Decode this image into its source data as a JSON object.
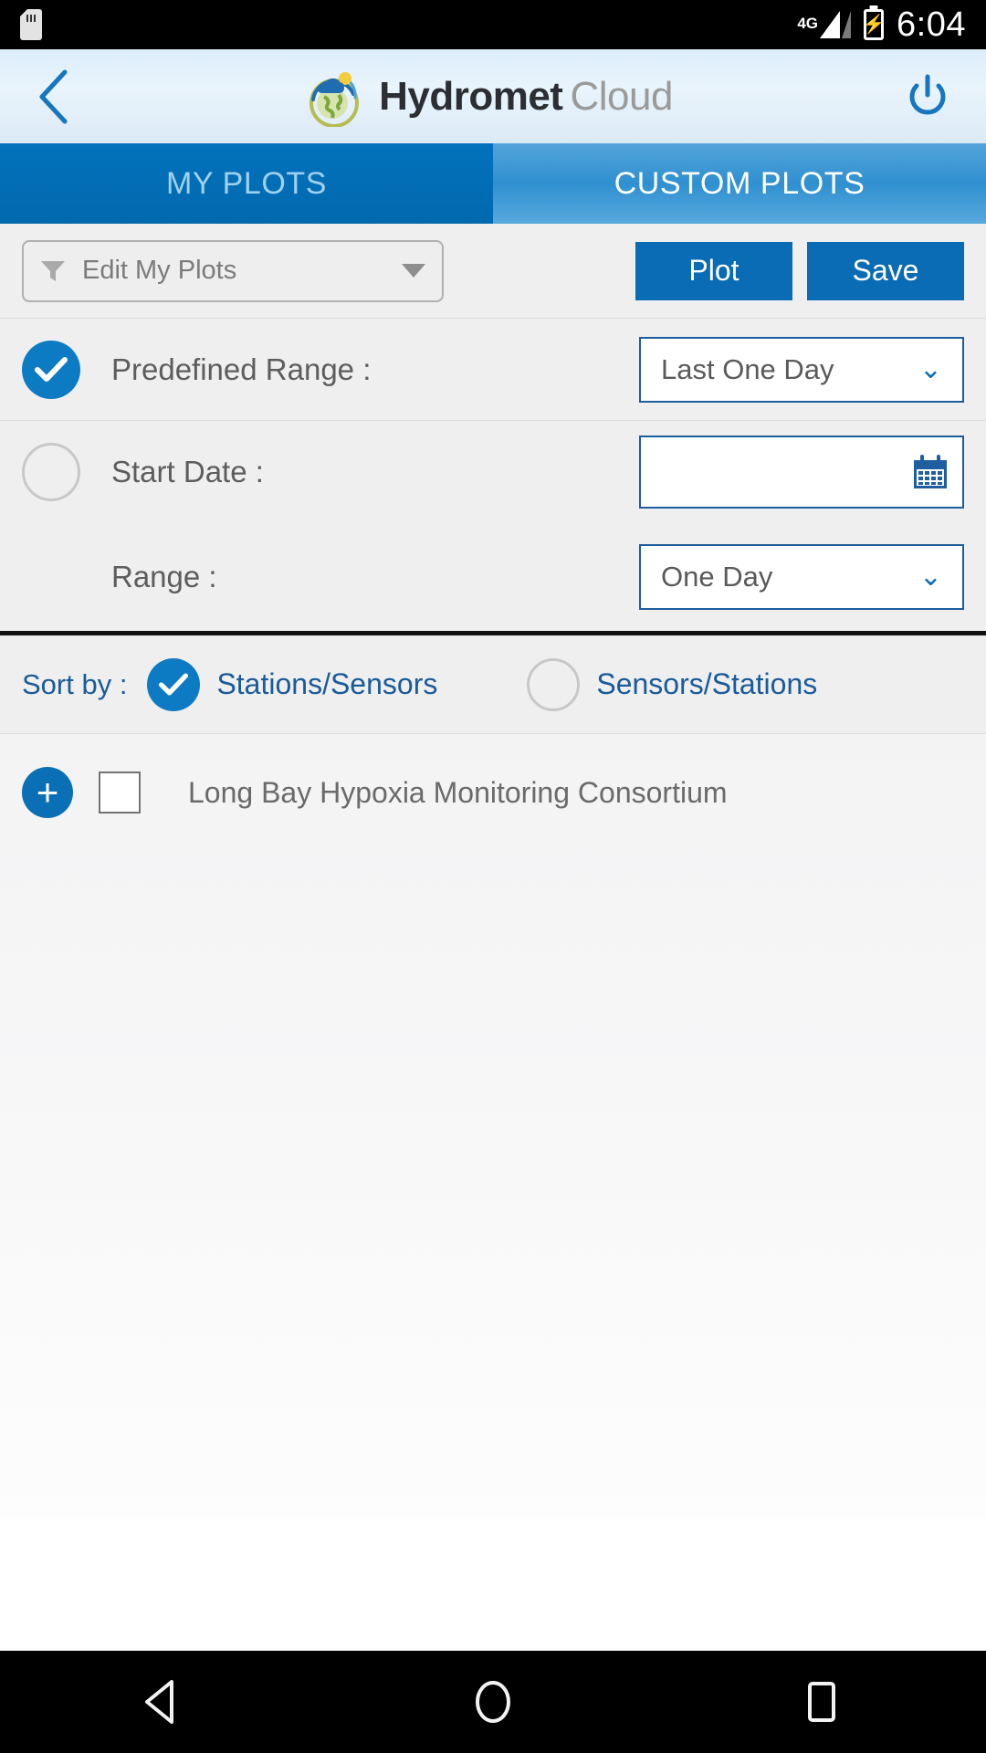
{
  "statusbar": {
    "sd_icon": "sd-card-icon",
    "network_label": "4G",
    "signal_icon": "signal-bars-icon",
    "battery_icon": "battery-charging-icon",
    "time": "6:04"
  },
  "appbar": {
    "back_icon": "back-chevron-icon",
    "logo_icon": "hydromet-globe-logo-icon",
    "brand_primary": "Hydromet",
    "brand_secondary": "Cloud",
    "power_icon": "power-icon"
  },
  "tabs": [
    {
      "label": "MY PLOTS",
      "active": true
    },
    {
      "label": "CUSTOM PLOTS",
      "active": false
    }
  ],
  "toolbar": {
    "filter_icon": "funnel-filter-icon",
    "edit_plots_label": "Edit My Plots",
    "dropdown_icon": "caret-down-icon",
    "plot_label": "Plot",
    "save_label": "Save"
  },
  "range_section": {
    "predefined": {
      "label": "Predefined Range :",
      "selected": true,
      "value": "Last One Day",
      "chevron": "⌄"
    },
    "start_date": {
      "label": "Start Date :",
      "selected": false,
      "value": "",
      "calendar_icon": "calendar-icon"
    },
    "range": {
      "label": "Range :",
      "value": "One Day",
      "chevron": "⌄"
    }
  },
  "sort": {
    "title": "Sort by :",
    "options": [
      {
        "label": "Stations/Sensors",
        "selected": true
      },
      {
        "label": "Sensors/Stations",
        "selected": false
      }
    ]
  },
  "stations": [
    {
      "add_icon": "plus-circle-icon",
      "checkbox_icon": "checkbox-unchecked-icon",
      "name": "Long Bay Hypoxia Monitoring Consortium",
      "checked": false
    }
  ],
  "navbar": {
    "back_icon": "nav-back-triangle-icon",
    "home_icon": "nav-home-circle-icon",
    "recents_icon": "nav-recents-square-icon"
  },
  "colors": {
    "accent_blue": "#0a6cb4",
    "tab_active": "#0069ae",
    "tab_inactive": "#3f99d6",
    "border_blue": "#1c5e9b",
    "text_gray": "#5d5d5d",
    "link_blue": "#1a5b99"
  }
}
